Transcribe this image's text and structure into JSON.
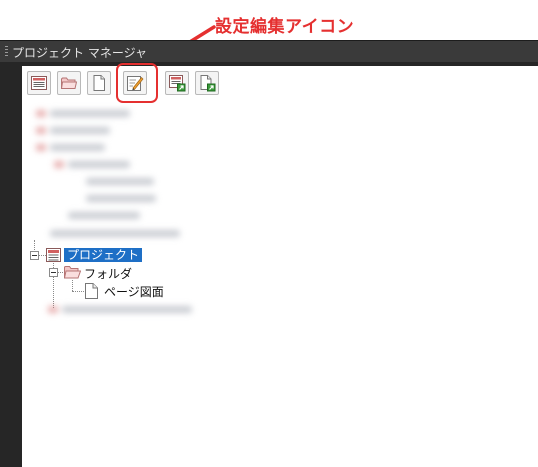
{
  "annotation": {
    "label": "設定編集アイコン",
    "color": "#e53030"
  },
  "panel": {
    "title": "プロジェクト マネージャ"
  },
  "toolbar": {
    "buttons": [
      {
        "icon": "project-icon"
      },
      {
        "icon": "folder-icon"
      },
      {
        "icon": "page-icon"
      },
      {
        "icon": "edit-settings-icon",
        "highlighted": true
      },
      {
        "icon": "project-link-icon"
      },
      {
        "icon": "page-link-icon"
      }
    ]
  },
  "tree": {
    "project_label": "プロジェクト",
    "folder_label": "フォルダ",
    "page_label": "ページ図面"
  },
  "colors": {
    "selection": "#1e6fc6",
    "panel_dark": "#262626",
    "header": "#3a3a3a"
  }
}
